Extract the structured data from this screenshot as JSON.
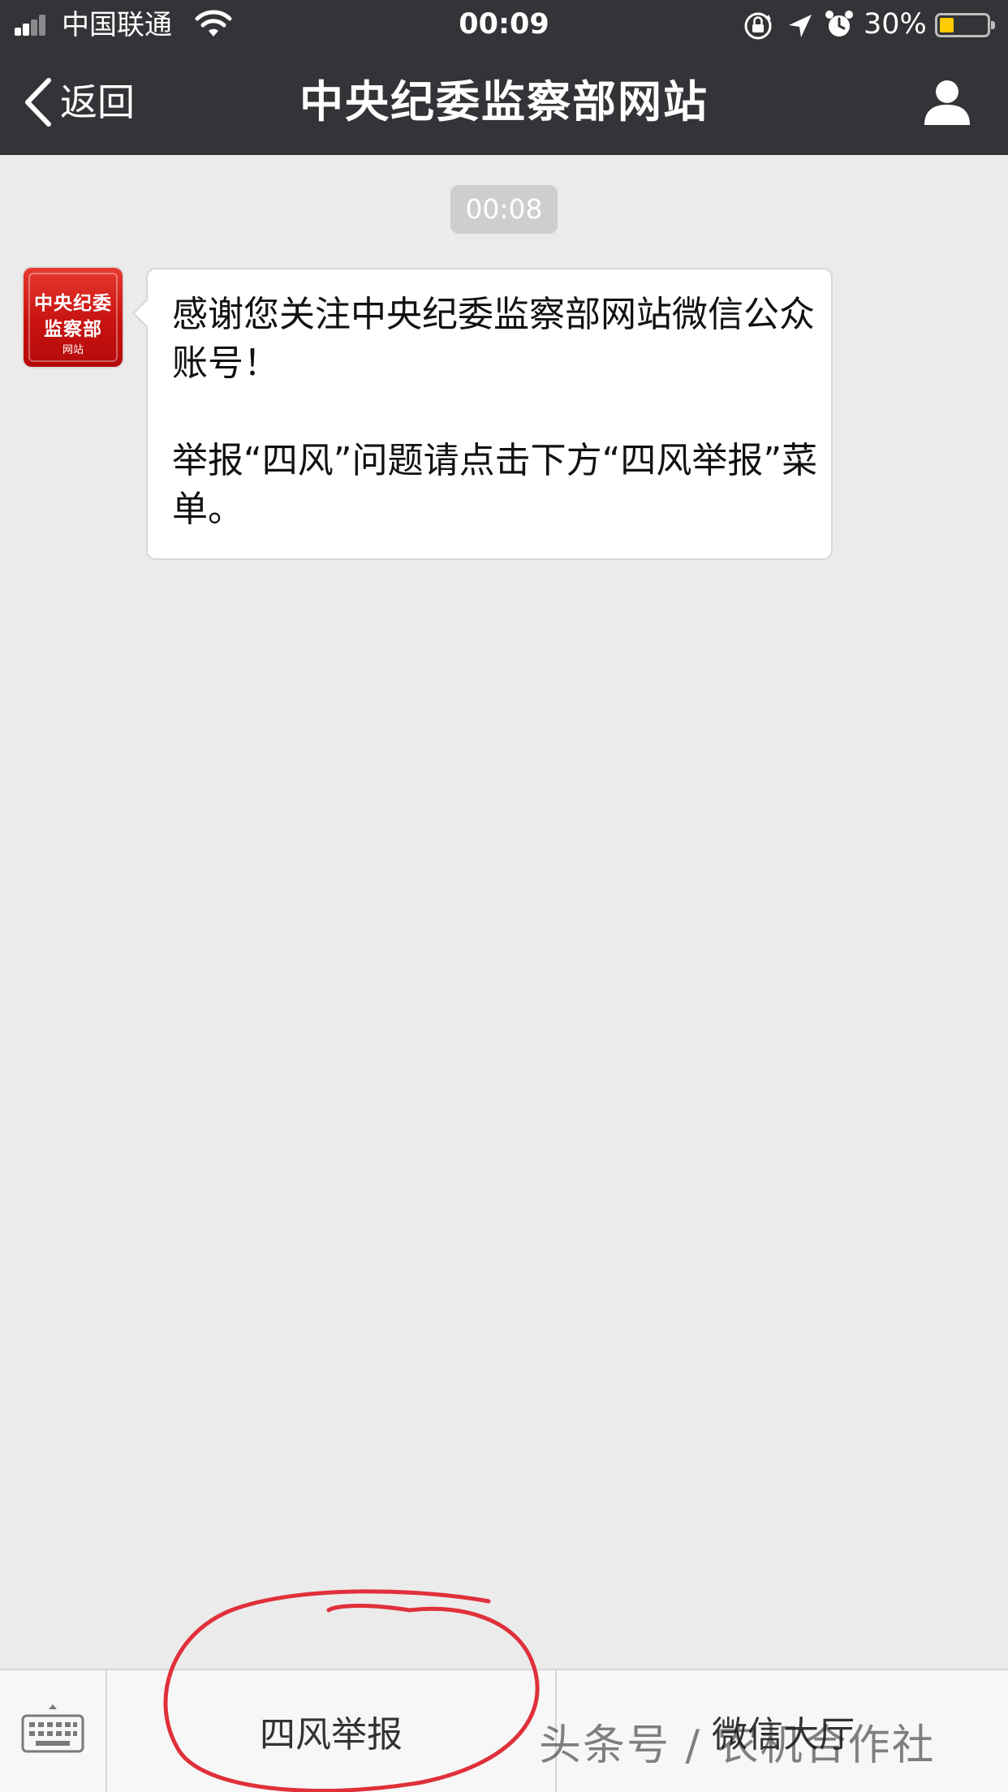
{
  "status_bar": {
    "carrier": "中国联通",
    "time": "00:09",
    "battery_percent": "30%",
    "battery_level": 0.3,
    "signal_bars_filled": 2,
    "signal_bars_total": 4,
    "icons": [
      "signal-icon",
      "wifi-icon",
      "orientation-lock-icon",
      "location-arrow-icon",
      "alarm-icon",
      "battery-icon"
    ]
  },
  "nav": {
    "back_label": "返回",
    "title": "中央纪委监察部网站",
    "profile_icon": "person-icon"
  },
  "chat": {
    "timestamp": "00:08",
    "avatar": {
      "line1": "中央纪委",
      "line2": "监察部",
      "line3": "网站",
      "color": "#d0150f"
    },
    "message": {
      "paragraph1": "感谢您关注中央纪委监察部网站微信公众账号！",
      "paragraph2": "举报“四风”问题请点击下方“四风举报”菜单。"
    }
  },
  "menu": {
    "keyboard_icon": "keyboard-icon",
    "item1": "四风举报",
    "item2": "微信大厅"
  },
  "watermark": "头条号 / 农机合作社",
  "colors": {
    "header_bg": "#333437",
    "chat_bg": "#ebebeb",
    "annotation_red": "#e0303a",
    "battery_yellow": "#ffcc00"
  }
}
